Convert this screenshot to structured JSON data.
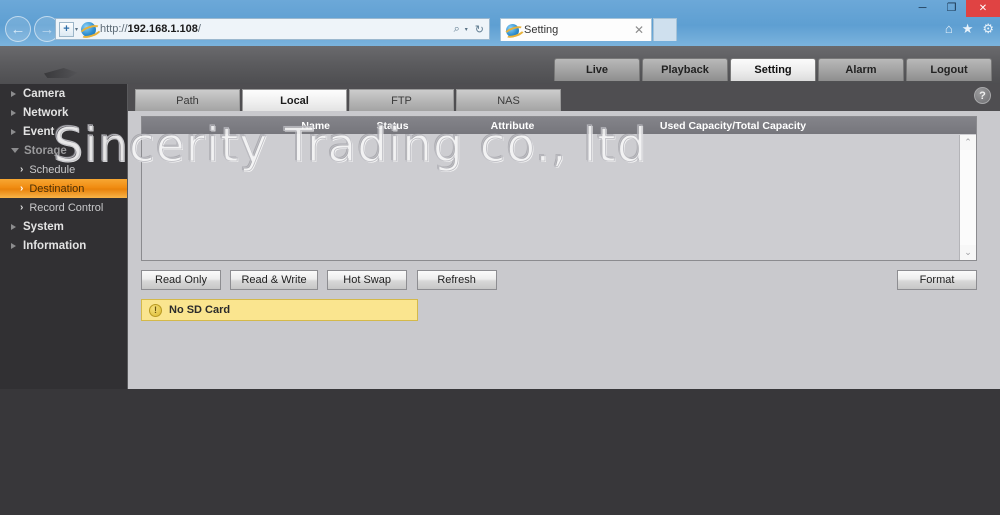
{
  "browser": {
    "url_scheme": "http://",
    "url_host": "192.168.1.108",
    "url_path": "/",
    "compat_icon": "compatibility-view-plus",
    "search_icon": "search-magnifier-icon",
    "search_caret": "▾",
    "refresh_icon": "↻",
    "back_icon": "←",
    "forward_icon": "→",
    "tab_title": "Setting",
    "tab_close": "✕",
    "tools": {
      "home": "⌂",
      "favorites": "★",
      "settings": "⚙"
    },
    "window": {
      "minimize": "─",
      "maximize": "❐",
      "close": "✕"
    }
  },
  "topnav": {
    "items": [
      {
        "label": "Live",
        "active": false
      },
      {
        "label": "Playback",
        "active": false
      },
      {
        "label": "Setting",
        "active": true
      },
      {
        "label": "Alarm",
        "active": false
      },
      {
        "label": "Logout",
        "active": false
      }
    ]
  },
  "sidebar": {
    "items": [
      {
        "label": "Camera"
      },
      {
        "label": "Network"
      },
      {
        "label": "Event"
      },
      {
        "label": "Storage"
      }
    ],
    "storage_children": [
      {
        "label": "Schedule",
        "chevron": "›",
        "selected": false
      },
      {
        "label": "Destination",
        "chevron": "›",
        "selected": true
      },
      {
        "label": "Record Control",
        "chevron": "›",
        "selected": false
      }
    ],
    "items_after": [
      {
        "label": "System"
      },
      {
        "label": "Information"
      }
    ]
  },
  "subtabs": {
    "items": [
      {
        "label": "Path",
        "active": false
      },
      {
        "label": "Local",
        "active": true
      },
      {
        "label": "FTP",
        "active": false
      },
      {
        "label": "NAS",
        "active": false
      }
    ],
    "help": "?"
  },
  "table": {
    "columns": {
      "name": "Name",
      "status": "Status",
      "attribute": "Attribute",
      "capacity": "Used Capacity/Total Capacity"
    },
    "rows": [],
    "scroll": {
      "up": "⌃",
      "down": "⌄"
    }
  },
  "watermark": "Sincerity Trading co., ltd",
  "buttons": {
    "read_only": "Read Only",
    "read_write": "Read & Write",
    "hot_swap": "Hot Swap",
    "refresh": "Refresh",
    "format": "Format"
  },
  "warning": {
    "icon": "!",
    "message": "No SD Card"
  },
  "colors": {
    "accent_orange": "#f08a10",
    "warning_bg": "#fae58f",
    "panel_bg": "#c9c9cd",
    "chrome_blue": "#66a4d4"
  }
}
